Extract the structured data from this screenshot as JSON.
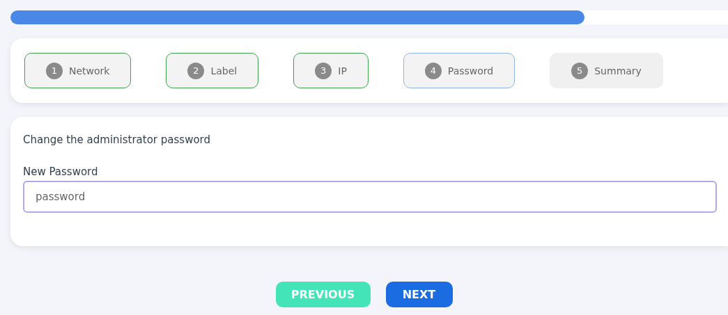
{
  "progress": {
    "level": 0.8
  },
  "steps": [
    {
      "number": "1",
      "label": "Network",
      "completed": true,
      "selected": false
    },
    {
      "number": "2",
      "label": "Label",
      "completed": true,
      "selected": false
    },
    {
      "number": "3",
      "label": "IP",
      "completed": true,
      "selected": false
    },
    {
      "number": "4",
      "label": "Password",
      "completed": false,
      "selected": true
    },
    {
      "number": "5",
      "label": "Summary",
      "completed": false,
      "selected": false
    }
  ],
  "form": {
    "heading": "Change the administrator password",
    "field_label": "New Password",
    "value": "password"
  },
  "buttons": [
    {
      "label": "PREVIOUS",
      "kind": "secondary"
    },
    {
      "label": "NEXT",
      "kind": "primary"
    }
  ]
}
